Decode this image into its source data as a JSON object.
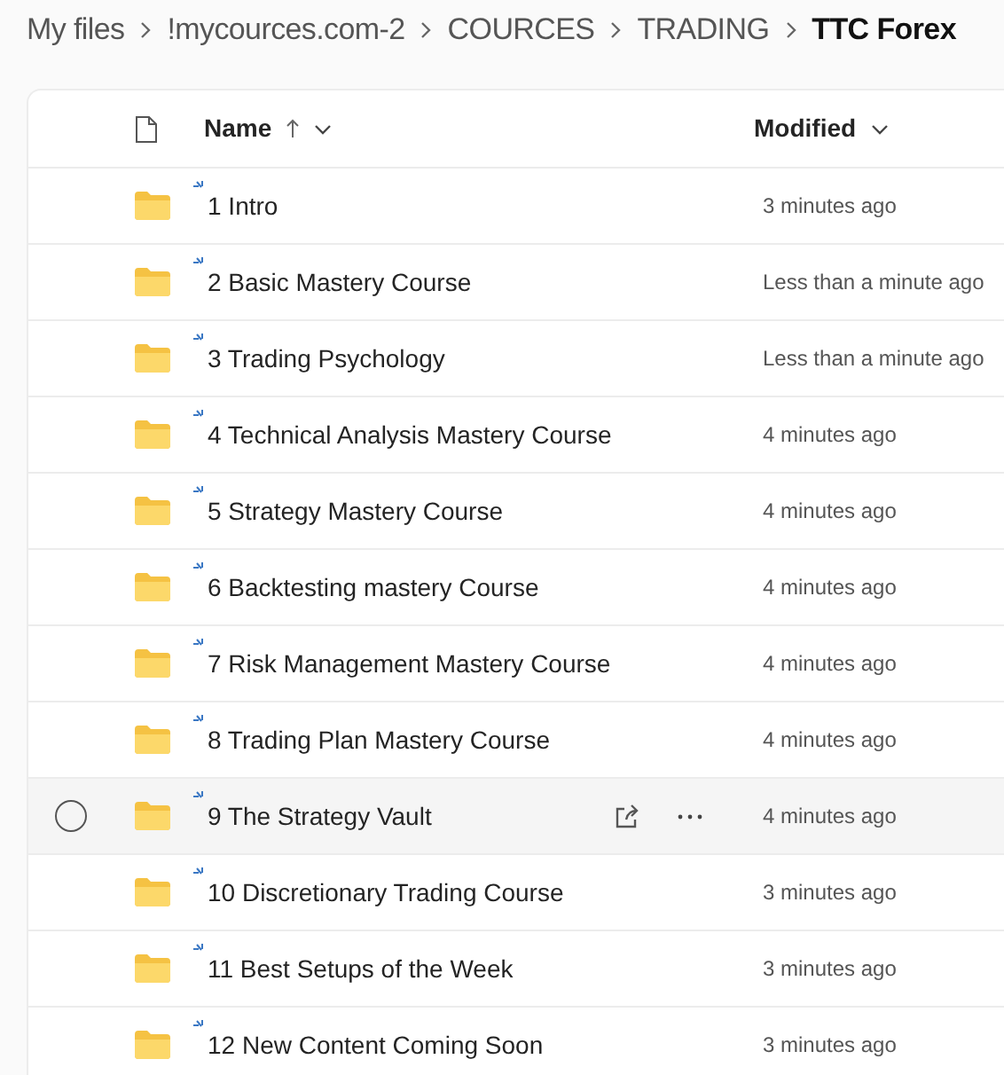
{
  "breadcrumb": [
    {
      "label": "My files",
      "current": false
    },
    {
      "label": "!mycources.com-2",
      "current": false
    },
    {
      "label": "COURCES",
      "current": false
    },
    {
      "label": "TRADING",
      "current": false
    },
    {
      "label": "TTC Forex",
      "current": true
    }
  ],
  "table": {
    "columns": [
      {
        "label": "Name",
        "sorted": true
      },
      {
        "label": "Modified",
        "sorted": false
      }
    ],
    "rows": [
      {
        "name": "1 Intro",
        "modified": "3 minutes ago",
        "hovered": false
      },
      {
        "name": "2 Basic Mastery Course",
        "modified": "Less than a minute ago",
        "hovered": false
      },
      {
        "name": "3 Trading Psychology",
        "modified": "Less than a minute ago",
        "hovered": false
      },
      {
        "name": "4 Technical Analysis Mastery Course",
        "modified": "4 minutes ago",
        "hovered": false
      },
      {
        "name": "5 Strategy Mastery Course",
        "modified": "4 minutes ago",
        "hovered": false
      },
      {
        "name": "6 Backtesting mastery Course",
        "modified": "4 minutes ago",
        "hovered": false
      },
      {
        "name": "7 Risk Management Mastery Course",
        "modified": "4 minutes ago",
        "hovered": false
      },
      {
        "name": "8 Trading Plan Mastery Course",
        "modified": "4 minutes ago",
        "hovered": false
      },
      {
        "name": "9 The Strategy Vault",
        "modified": "4 minutes ago",
        "hovered": true
      },
      {
        "name": "10 Discretionary Trading Course",
        "modified": "3 minutes ago",
        "hovered": false
      },
      {
        "name": "11 Best Setups of the Week",
        "modified": "3 minutes ago",
        "hovered": false
      },
      {
        "name": "12 New Content Coming Soon",
        "modified": "3 minutes ago",
        "hovered": false
      }
    ]
  }
}
